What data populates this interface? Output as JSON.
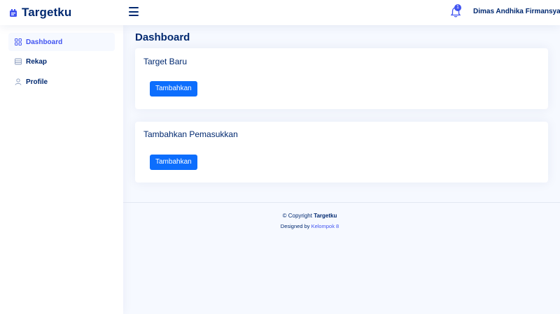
{
  "header": {
    "app_name": "Targetku",
    "notification_count": "1",
    "user_name": "Dimas Andhika Firmansyah"
  },
  "sidebar": {
    "items": [
      {
        "label": "Dashboard",
        "icon": "grid-icon",
        "active": true
      },
      {
        "label": "Rekap",
        "icon": "layout-icon",
        "active": false
      },
      {
        "label": "Profile",
        "icon": "person-icon",
        "active": false
      }
    ]
  },
  "main": {
    "page_title": "Dashboard",
    "cards": [
      {
        "title": "Target Baru",
        "button_label": "Tambahkan"
      },
      {
        "title": "Tambahkan Pemasukkan",
        "button_label": "Tambahkan"
      }
    ]
  },
  "footer": {
    "copyright_prefix": "© Copyright",
    "copyright_brand": "Targetku",
    "credits_prefix": "Designed by",
    "credits_link": "Kelompok 8"
  },
  "colors": {
    "primary_text": "#012970",
    "accent": "#4154f1",
    "button": "#0d6efd",
    "background": "#f6f9ff"
  }
}
